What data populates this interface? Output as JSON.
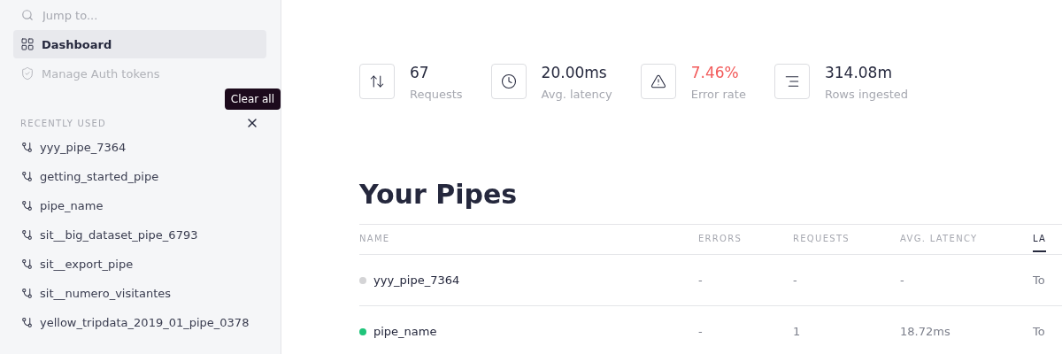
{
  "sidebar": {
    "search": {
      "placeholder": "Jump to..."
    },
    "nav": [
      {
        "label": "Dashboard",
        "kind": "grid",
        "selected": true,
        "disabled": false
      },
      {
        "label": "Manage Auth tokens",
        "kind": "shield",
        "selected": false,
        "disabled": true
      }
    ],
    "tooltip": "Clear all",
    "recent_title": "RECENTLY USED",
    "recent": [
      "yyy_pipe_7364",
      "getting_started_pipe",
      "pipe_name",
      "sit__big_dataset_pipe_6793",
      "sit__export_pipe",
      "sit__numero_visitantes",
      "yellow_tripdata_2019_01_pipe_0378"
    ]
  },
  "stats": [
    {
      "kind": "arrows",
      "value": "67",
      "label": "Requests",
      "alert": false
    },
    {
      "kind": "clock",
      "value": "20.00ms",
      "label": "Avg. latency",
      "alert": false
    },
    {
      "kind": "warning",
      "value": "7.46%",
      "label": "Error rate",
      "alert": true
    },
    {
      "kind": "lines",
      "value": "314.08m",
      "label": "Rows ingested",
      "alert": false
    }
  ],
  "title": "Your Pipes",
  "table": {
    "columns": [
      {
        "label": "NAME",
        "selected": false
      },
      {
        "label": "ERRORS",
        "selected": false
      },
      {
        "label": "REQUESTS",
        "selected": false
      },
      {
        "label": "AVG. LATENCY",
        "selected": false
      },
      {
        "label": "LA",
        "selected": true
      }
    ],
    "rows": [
      {
        "name": "yyy_pipe_7364",
        "color": "#d4d4d6",
        "errors": "-",
        "requests": "-",
        "latency": "-",
        "column_5": "To"
      },
      {
        "name": "pipe_name",
        "color": "#1fc47a",
        "errors": "-",
        "requests": "1",
        "latency": "18.72ms",
        "column_5": "To"
      }
    ]
  }
}
